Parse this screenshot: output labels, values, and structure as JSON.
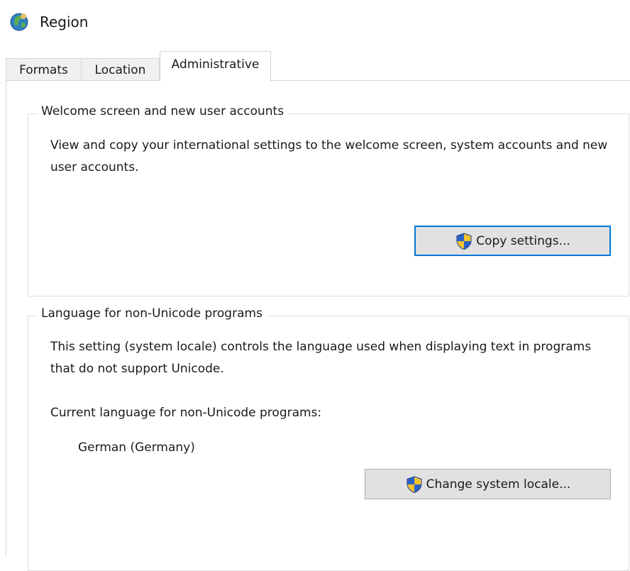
{
  "window": {
    "title": "Region",
    "icon": "globe-icon"
  },
  "tabs": [
    {
      "label": "Formats",
      "selected": false
    },
    {
      "label": "Location",
      "selected": false
    },
    {
      "label": "Administrative",
      "selected": true
    }
  ],
  "welcome_group": {
    "title": "Welcome screen and new user accounts",
    "description": "View and copy your international settings to the welcome screen, system accounts and new user accounts.",
    "button_label": "Copy settings...",
    "button_icon": "uac-shield-icon"
  },
  "language_group": {
    "title": "Language for non-Unicode programs",
    "description": "This setting (system locale) controls the language used when displaying text in programs that do not support Unicode.",
    "current_label": "Current language for non-Unicode programs:",
    "current_value": "German (Germany)",
    "button_label": "Change system locale...",
    "button_icon": "uac-shield-icon"
  },
  "colors": {
    "default_button_border": "#0078d7",
    "button_face": "#e1e1e1"
  }
}
